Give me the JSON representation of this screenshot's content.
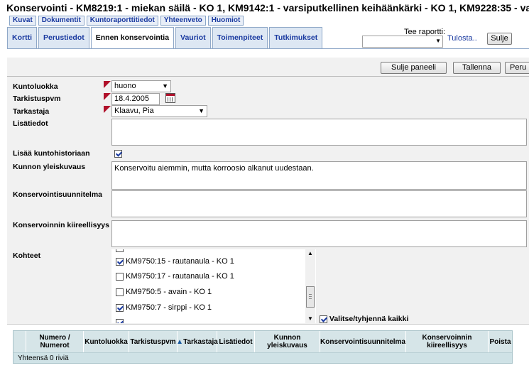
{
  "window": {
    "title": "Konservointi  - KM8219:1 - miekan säilä - KO 1, KM9142:1 - varsiputkellinen keihäänkärki - KO 1, KM9228:35 - varsip"
  },
  "toplinks": [
    "Kuvat",
    "Dokumentit",
    "Kuntoraporttitiedot",
    "Yhteenveto",
    "Huomiot"
  ],
  "tabs": [
    "Kortti",
    "Perustiedot",
    "Ennen konservointia",
    "Vauriot",
    "Toimenpiteet",
    "Tutkimukset"
  ],
  "active_tab": "Ennen konservointia",
  "report": {
    "label": "Tee raportti:",
    "selected": "",
    "print_link": "Tulosta..",
    "close_button": "Sulje"
  },
  "panel_buttons": {
    "close_panel": "Sulje paneeli",
    "save": "Tallenna",
    "cancel": "Peru"
  },
  "form": {
    "kuntoluokka": {
      "label": "Kuntoluokka",
      "value": "huono"
    },
    "tarkistuspvm": {
      "label": "Tarkistuspvm",
      "value": "18.4.2005"
    },
    "tarkastaja": {
      "label": "Tarkastaja",
      "value": "Klaavu, Pia"
    },
    "lisatiedot": {
      "label": "Lisätiedot",
      "value": ""
    },
    "lisaa_kuntohistoriaan": {
      "label": "Lisää kuntohistoriaan",
      "checked": true
    },
    "kunnon_yleiskuvaus": {
      "label": "Kunnon yleiskuvaus",
      "value": "Konservoitu aiemmin, mutta korroosio alkanut uudestaan."
    },
    "konservointisuunnitelma": {
      "label": "Konservointisuunnitelma",
      "value": ""
    },
    "kiireellisyys": {
      "label": "Konservoinnin kiireellisyys",
      "value": ""
    },
    "kohteet": {
      "label": "Kohteet",
      "items": [
        {
          "label": "KM9750:15 - rautanaula - KO 1",
          "checked": true
        },
        {
          "label": "KM9750:17 - rautanaula - KO 1",
          "checked": false
        },
        {
          "label": "KM9750:5 - avain - KO 1",
          "checked": false
        },
        {
          "label": "KM9750:7 - sirppi - KO 1",
          "checked": true
        }
      ],
      "select_all_label": "Valitse/tyhjennä kaikki",
      "select_all_checked": true
    }
  },
  "grid": {
    "columns": [
      "Numero / Numerot",
      "Kuntoluokka",
      "Tarkistuspvm",
      "Tarkastaja",
      "Lisätiedot",
      "Kunnon yleiskuvaus",
      "Konservointisuunnitelma",
      "Konservoinnin kiireellisyys",
      "Poista"
    ],
    "sort_indicator": "▲",
    "footer": "Yhteensä 0 riviä"
  }
}
